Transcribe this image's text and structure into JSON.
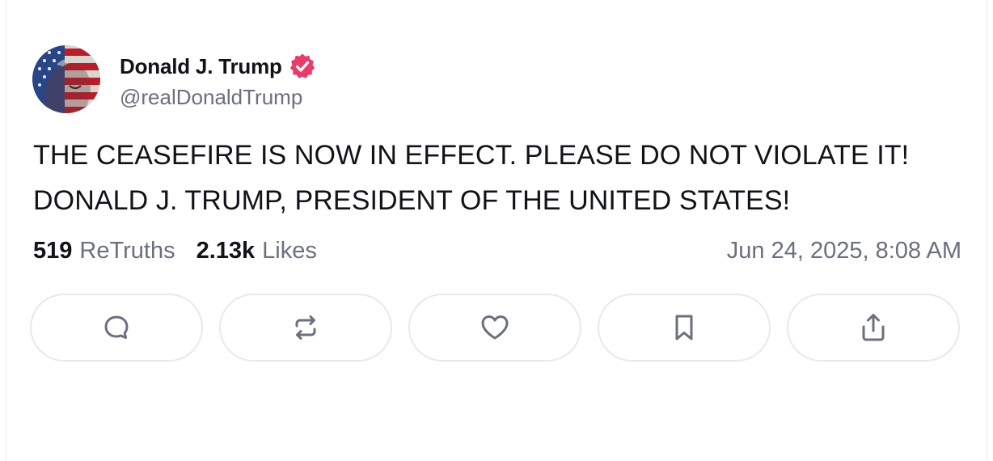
{
  "author": {
    "name": "Donald J. Trump",
    "handle": "@realDonaldTrump",
    "verified": true,
    "verified_color": "#e83c6b",
    "avatar_icon": "flag-portrait-avatar"
  },
  "post": {
    "lines": [
      "THE CEASEFIRE IS NOW IN EFFECT. PLEASE DO NOT VIOLATE IT!",
      "DONALD J. TRUMP, PRESIDENT OF THE UNITED STATES!"
    ]
  },
  "stats": {
    "retruths_count": "519",
    "retruths_label": "ReTruths",
    "likes_count": "2.13k",
    "likes_label": "Likes",
    "timestamp": "Jun 24, 2025, 8:08 AM"
  },
  "actions": [
    {
      "icon": "reply-icon"
    },
    {
      "icon": "retruth-icon"
    },
    {
      "icon": "like-icon"
    },
    {
      "icon": "bookmark-icon"
    },
    {
      "icon": "share-icon"
    }
  ],
  "colors": {
    "text": "#111318",
    "muted": "#6b6f7e",
    "border": "#e8e8ee",
    "icon": "#6b6f7e"
  }
}
